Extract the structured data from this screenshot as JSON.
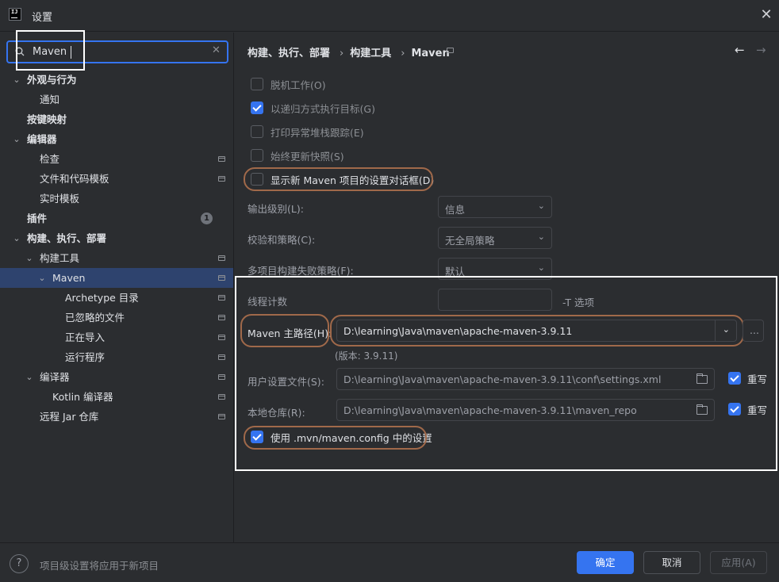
{
  "window": {
    "title": "设置"
  },
  "search": {
    "value": "Maven"
  },
  "tree": [
    {
      "label": "外观与行为",
      "bold": true,
      "chev": "⌄",
      "level": 0
    },
    {
      "label": "通知",
      "bold": false,
      "level": 1
    },
    {
      "label": "按键映射",
      "bold": true,
      "level": 0
    },
    {
      "label": "编辑器",
      "bold": true,
      "chev": "⌄",
      "level": 0
    },
    {
      "label": "检查",
      "bold": false,
      "level": 1,
      "proj": true
    },
    {
      "label": "文件和代码模板",
      "bold": false,
      "level": 1,
      "proj": true
    },
    {
      "label": "实时模板",
      "bold": false,
      "level": 1
    },
    {
      "label": "插件",
      "bold": true,
      "level": 0,
      "badge": "1"
    },
    {
      "label": "构建、执行、部署",
      "bold": true,
      "chev": "⌄",
      "level": 0
    },
    {
      "label": "构建工具",
      "bold": false,
      "chev": "⌄",
      "level": 1,
      "proj": true
    },
    {
      "label": "Maven",
      "bold": false,
      "chev": "⌄",
      "level": 2,
      "proj": true,
      "selected": true
    },
    {
      "label": "Archetype 目录",
      "bold": false,
      "level": 3,
      "proj": true
    },
    {
      "label": "已忽略的文件",
      "bold": false,
      "level": 3,
      "proj": true
    },
    {
      "label": "正在导入",
      "bold": false,
      "level": 3,
      "proj": true
    },
    {
      "label": "运行程序",
      "bold": false,
      "level": 3,
      "proj": true
    },
    {
      "label": "编译器",
      "bold": false,
      "chev": "⌄",
      "level": 1,
      "proj": true
    },
    {
      "label": "Kotlin 编译器",
      "bold": false,
      "level": 2,
      "proj": true
    },
    {
      "label": "远程 Jar 仓库",
      "bold": false,
      "level": 1,
      "proj": true
    }
  ],
  "breadcrumb": {
    "part1": "构建、执行、部署",
    "part2": "构建工具",
    "part3": "Maven",
    "sep": "›"
  },
  "nav": {
    "back": "←",
    "forward": "→"
  },
  "options": {
    "offline": {
      "label": "脱机工作(O)",
      "checked": false
    },
    "recursive": {
      "label": "以递归方式执行目标(G)",
      "checked": true
    },
    "stacktrace": {
      "label": "打印异常堆栈跟踪(E)",
      "checked": false
    },
    "update_snapshots": {
      "label": "始终更新快照(S)",
      "checked": false
    },
    "show_dialog": {
      "label": "显示新 Maven 项目的设置对话框(D)",
      "checked": false
    }
  },
  "fields": {
    "output_level": {
      "label": "输出级别(L):",
      "value": "信息"
    },
    "checksum_policy": {
      "label": "校验和策略(C):",
      "value": "无全局策略"
    },
    "multiproject_fail": {
      "label": "多项目构建失败策略(F):",
      "value": "默认"
    },
    "thread_count": {
      "label": "线程计数",
      "value": "",
      "suffix": "-T 选项"
    },
    "maven_home": {
      "label": "Maven 主路径(H):",
      "value": "D:\\learning\\Java\\maven\\apache-maven-3.9.11",
      "more": "...",
      "version": "(版本: 3.9.11)"
    },
    "user_settings": {
      "label": "用户设置文件(S):",
      "value": "D:\\learning\\Java\\maven\\apache-maven-3.9.11\\conf\\settings.xml",
      "override_label": "重写",
      "override": true
    },
    "local_repo": {
      "label": "本地仓库(R):",
      "value": "D:\\learning\\Java\\maven\\apache-maven-3.9.11\\maven_repo",
      "override_label": "重写",
      "override": true
    },
    "use_mvn_config": {
      "label": "使用 .mvn/maven.config 中的设置",
      "checked": true
    }
  },
  "footer": {
    "help": "?",
    "hint": "项目级设置将应用于新项目",
    "ok": "确定",
    "cancel": "取消",
    "apply": "应用(A)"
  },
  "colors": {
    "accent": "#3574f0",
    "highlight_orange": "#a0694a",
    "selected_row": "#2e436e"
  }
}
